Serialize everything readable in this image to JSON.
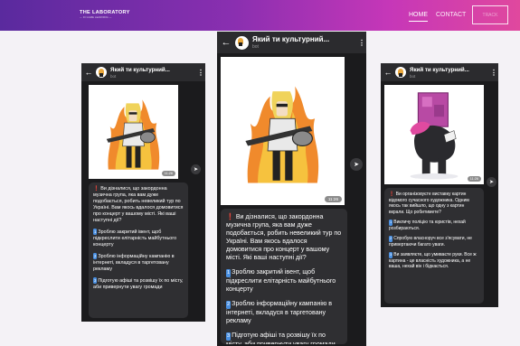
{
  "header": {
    "logo_title": "THE LABORATORY",
    "logo_subtitle": "— IN GAME LEARNING —",
    "nav_home": "HOME",
    "nav_contact": "CONTACT",
    "nav_button": "TRACK"
  },
  "colors": {
    "header_gradient_start": "#5a2a9e",
    "header_gradient_end": "#e0489e",
    "page_background": "#f4f2f6",
    "phone_background": "#1b1b1d"
  },
  "phones": [
    {
      "title": "Який ти культурний...",
      "subtitle": "bot",
      "time": "11:26",
      "paragraphs": [
        {
          "marker": "❗",
          "text": "Ви дізналися, що закордонна музична група, яка вам дуже подобається, робить невеликий тур по Україні. Вам якось вдалося домовитися про концерт у вашому місті. Які ваші наступні дії?"
        },
        {
          "marker": "1",
          "text": "Зроблю закритий івент, щоб підкреслити елітарність майбутнього концерту"
        },
        {
          "marker": "2",
          "text": "Зроблю інформаційну кампанію в інтернеті, вкладуся в таргетовану рекламу"
        },
        {
          "marker": "3",
          "text": "Підготую афіші та розвішу їх по місту, аби привернути увагу громади"
        }
      ]
    },
    {
      "title": "Який ти культурний...",
      "subtitle": "bot",
      "time": "11:26",
      "paragraphs": [
        {
          "marker": "❗",
          "text": "Ви дізналися, що закордонна музична група, яка вам дуже подобається, робить невеликий тур по Україні. Вам якось вдалося домовитися про концерт у вашому місті. Які ваші наступні дії?"
        },
        {
          "marker": "1",
          "text": "Зроблю закритий івент, щоб підкреслити елітарність майбутнього концерту"
        },
        {
          "marker": "2",
          "text": "Зроблю інформаційну кампанію в інтернеті, вкладуся в таргетовану рекламу"
        },
        {
          "marker": "3",
          "text": "Підготую афіші та розвішу їх по місту, аби привернути увагу громади"
        }
      ]
    },
    {
      "title": "Який ти культурний...",
      "subtitle": "bot",
      "time": "11:26",
      "paragraphs": [
        {
          "marker": "❗",
          "text": "Ви організовуєте виставку картин відомого сучасного художника. Одним якось так вийшло, що одну з картин вкрали. Що робитимете?"
        },
        {
          "marker": "1",
          "text": "Викличу поліцію та юристів, нехай розбираються."
        },
        {
          "marker": "2",
          "text": "Спробую власноруч все з'ясувати, не привертаючи багато уваги."
        },
        {
          "marker": "3",
          "text": "Ви заявляєте, що умиваєте руки. Все ж картина - це власність художника, а не ваша, нехай він і бідкається."
        }
      ]
    }
  ]
}
